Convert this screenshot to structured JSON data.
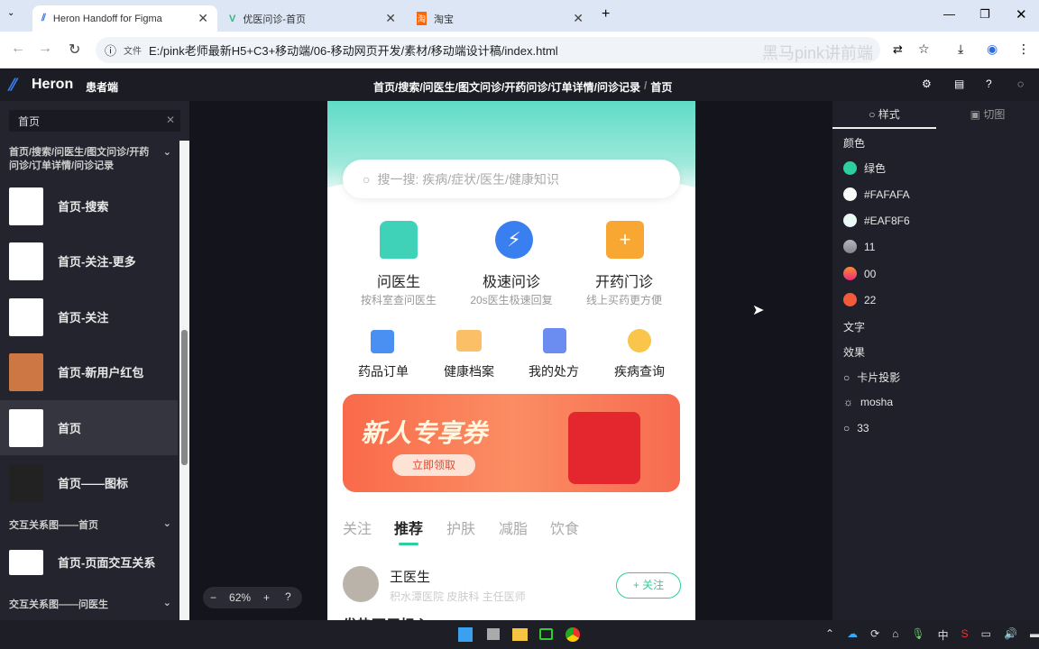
{
  "browser": {
    "tabs": [
      {
        "label": "Heron Handoff for Figma"
      },
      {
        "label": "优医问诊-首页"
      },
      {
        "label": "淘宝"
      }
    ],
    "url_prefix": "文件",
    "url": "E:/pink老师最新H5+C3+移动端/06-移动网页开发/素材/移动端设计稿/index.html",
    "watermark": "黑马pink讲前端"
  },
  "header": {
    "logo": "Heron",
    "subtitle": "患者端",
    "breadcrumb": "首页/搜索/问医生/图文问诊/开药问诊/订单详情/问诊记录",
    "current": "首页"
  },
  "sidebar": {
    "search_value": "首页",
    "group1": "首页/搜索/问医生/图文问诊/开药问诊/订单详情/问诊记录",
    "items": [
      {
        "label": "首页-搜索"
      },
      {
        "label": "首页-关注-更多"
      },
      {
        "label": "首页-关注"
      },
      {
        "label": "首页-新用户红包"
      },
      {
        "label": "首页"
      },
      {
        "label": "首页——图标"
      }
    ],
    "group2": "交互关系图——首页",
    "item7": "首页-页面交互关系",
    "group3": "交互关系图——问医生"
  },
  "zoom": {
    "value": "62%"
  },
  "phone": {
    "search_placeholder": "搜一搜: 疾病/症状/医生/健康知识",
    "services": [
      {
        "title": "问医生",
        "sub": "按科室查问医生"
      },
      {
        "title": "极速问诊",
        "sub": "20s医生极速回复"
      },
      {
        "title": "开药门诊",
        "sub": "线上买药更方便"
      }
    ],
    "quick": [
      {
        "label": "药品订单"
      },
      {
        "label": "健康档案"
      },
      {
        "label": "我的处方"
      },
      {
        "label": "疾病查询"
      }
    ],
    "banner": {
      "title": "新人专享券",
      "button": "立即领取"
    },
    "tabs": [
      {
        "label": "关注"
      },
      {
        "label": "推荐"
      },
      {
        "label": "护肤"
      },
      {
        "label": "减脂"
      },
      {
        "label": "饮食"
      }
    ],
    "doctor": {
      "name": "王医生",
      "info": "积水潭医院 皮肤科 主任医师",
      "follow": "+ 关注",
      "post": "发热不用担心"
    }
  },
  "right": {
    "tabs": [
      {
        "label": "样式"
      },
      {
        "label": "切图"
      }
    ],
    "colors_title": "颜色",
    "colors": [
      {
        "name": "绿色",
        "color": "#2ecf9f"
      },
      {
        "name": "#FAFAFA",
        "color": "#fafafa"
      },
      {
        "name": "#EAF8F6",
        "color": "#eaf8f6"
      },
      {
        "name": "11",
        "color": "#9a9aa2"
      },
      {
        "name": "00",
        "color": "#f0506e"
      },
      {
        "name": "22",
        "color": "#f25a3c"
      }
    ],
    "text_title": "文字",
    "effects_title": "效果",
    "effects": [
      {
        "name": "卡片投影"
      },
      {
        "name": "mosha"
      },
      {
        "name": "33"
      }
    ]
  },
  "taskbar": {
    "ime": "中"
  }
}
